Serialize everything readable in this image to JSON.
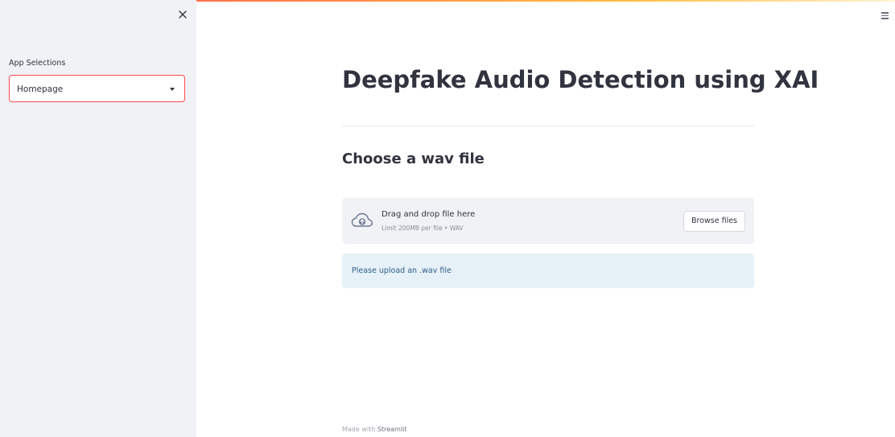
{
  "sidebar": {
    "close_icon": "close-icon",
    "select_label": "App Selections",
    "select_value": "Homepage",
    "caret_icon": "caret-down-icon"
  },
  "header": {
    "menu_icon": "hamburger-menu-icon",
    "accent_colors": [
      "#ff4b4b",
      "#ffbd45"
    ]
  },
  "main": {
    "title": "Deepfake Audio Detection using XAI",
    "subheader": "Choose a wav file",
    "uploader": {
      "icon": "cloud-upload-icon",
      "title": "Drag and drop file here",
      "limit": "Limit 200MB per file • WAV",
      "button_label": "Browse files"
    },
    "info_message": "Please upload an .wav file"
  },
  "footer": {
    "prefix": "Made with",
    "brand": "Streamlit"
  }
}
